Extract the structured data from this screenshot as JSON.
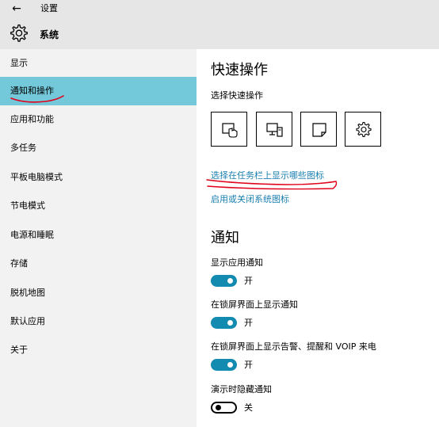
{
  "window": {
    "title": "设置",
    "back_icon": "back-arrow-icon"
  },
  "header": {
    "title": "系统",
    "icon": "gear-icon"
  },
  "sidebar": {
    "items": [
      {
        "label": "显示"
      },
      {
        "label": "通知和操作",
        "selected": true
      },
      {
        "label": "应用和功能"
      },
      {
        "label": "多任务"
      },
      {
        "label": "平板电脑模式"
      },
      {
        "label": "节电模式"
      },
      {
        "label": "电源和睡眠"
      },
      {
        "label": "存储"
      },
      {
        "label": "脱机地图"
      },
      {
        "label": "默认应用"
      },
      {
        "label": "关于"
      }
    ],
    "selected_color": "#73c8d9"
  },
  "quick_actions": {
    "heading": "快速操作",
    "subheading": "选择快速操作",
    "tiles": [
      {
        "icon": "tablet-mode-icon"
      },
      {
        "icon": "connect-display-icon"
      },
      {
        "icon": "note-icon"
      },
      {
        "icon": "settings-gear-icon"
      }
    ],
    "links": {
      "taskbar_icons": "选择在任务栏上显示哪些图标",
      "system_icons": "启用或关闭系统图标"
    }
  },
  "notifications": {
    "heading": "通知",
    "settings": [
      {
        "label": "显示应用通知",
        "state": "开",
        "on": true
      },
      {
        "label": "在锁屏界面上显示通知",
        "state": "开",
        "on": true
      },
      {
        "label": "在锁屏界面上显示告警、提醒和 VOIP 来电",
        "state": "开",
        "on": true
      },
      {
        "label": "演示时隐藏通知",
        "state": "关",
        "on": false
      }
    ]
  },
  "colors": {
    "accent": "#138bb0",
    "link": "#1a7fb0",
    "annotation": "#e0001a"
  }
}
